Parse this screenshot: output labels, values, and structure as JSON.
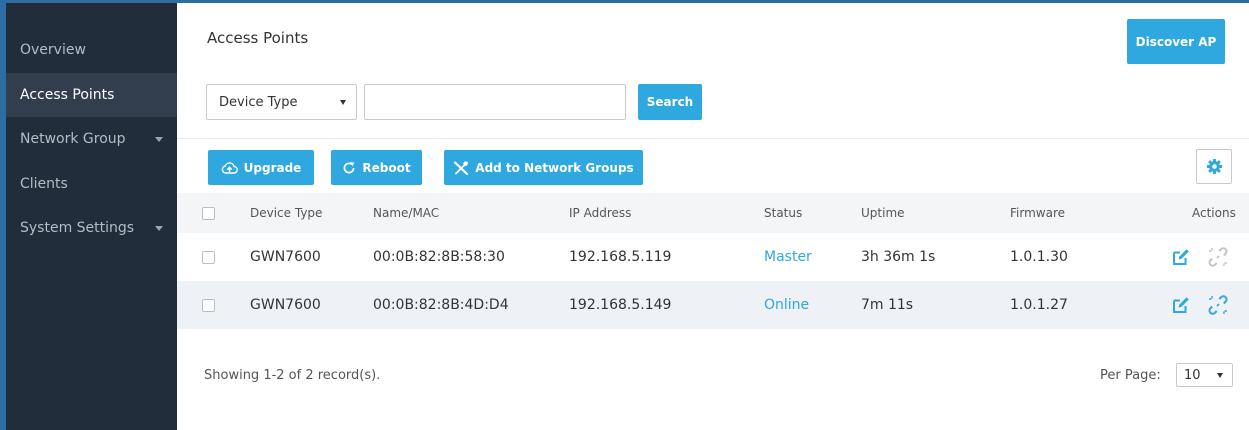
{
  "sidebar": {
    "items": [
      {
        "label": "Overview"
      },
      {
        "label": "Access Points"
      },
      {
        "label": "Network Group"
      },
      {
        "label": "Clients"
      },
      {
        "label": "System Settings"
      }
    ]
  },
  "header": {
    "title": "Access Points",
    "discover_label": "Discover AP"
  },
  "filter": {
    "device_type_label": "Device Type",
    "search_value": "",
    "search_label": "Search"
  },
  "toolbar": {
    "upgrade_label": "Upgrade",
    "reboot_label": "Reboot",
    "add_groups_label": "Add to Network Groups"
  },
  "table": {
    "columns": [
      "Device Type",
      "Name/MAC",
      "IP Address",
      "Status",
      "Uptime",
      "Firmware",
      "Actions"
    ],
    "rows": [
      {
        "device_type": "GWN7600",
        "mac": "00:0B:82:8B:58:30",
        "ip": "192.168.5.119",
        "status": "Master",
        "uptime": "3h 36m 1s",
        "firmware": "1.0.1.30"
      },
      {
        "device_type": "GWN7600",
        "mac": "00:0B:82:8B:4D:D4",
        "ip": "192.168.5.149",
        "status": "Online",
        "uptime": "7m 11s",
        "firmware": "1.0.1.27"
      }
    ]
  },
  "footer": {
    "showing": "Showing 1-2 of 2 record(s).",
    "per_page_label": "Per Page:",
    "per_page_value": "10"
  },
  "icons": {
    "upgrade": "cloud-upload-icon",
    "reboot": "refresh-icon",
    "add_groups": "tools-icon",
    "settings": "gear-icon",
    "edit": "edit-icon",
    "unlink": "unlink-icon"
  },
  "colors": {
    "accent": "#2ea8de",
    "sidebar_bg": "#222d3b",
    "sidebar_active": "#323e4e",
    "frame": "#2d6da3",
    "row_alt": "#eef1f5"
  }
}
